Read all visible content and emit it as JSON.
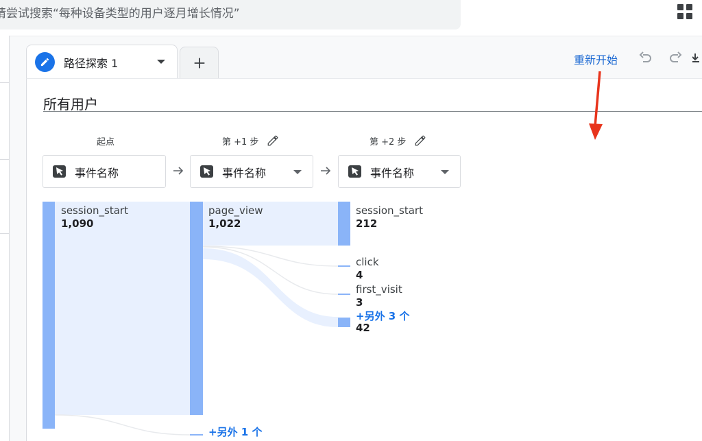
{
  "search": {
    "text": "请尝试搜索“每种设备类型的用户逐月增长情况”"
  },
  "tabs": [
    {
      "label": "路径探索 1"
    }
  ],
  "toolbar": {
    "restart_label": "重新开始"
  },
  "segment": {
    "label": "所有用户"
  },
  "columns": [
    {
      "heading": "起点",
      "node_label": "事件名称",
      "editable": false,
      "has_dropdown": false
    },
    {
      "heading": "第 +1 步",
      "node_label": "事件名称",
      "editable": true,
      "has_dropdown": true
    },
    {
      "heading": "第 +2 步",
      "node_label": "事件名称",
      "editable": true,
      "has_dropdown": true
    }
  ],
  "flow": {
    "step0": [
      {
        "name": "session_start",
        "count": "1,090"
      }
    ],
    "step1": [
      {
        "name": "page_view",
        "count": "1,022"
      },
      {
        "more": "+另外 1 个"
      }
    ],
    "step2": [
      {
        "name": "session_start",
        "count": "212"
      },
      {
        "name": "click",
        "count": "4"
      },
      {
        "name": "first_visit",
        "count": "3"
      },
      {
        "more": "+另外 3 个",
        "count": "42"
      }
    ]
  },
  "colors": {
    "bar": "#8ab4f8",
    "link": "#1a73e8",
    "flow": "#e8f0fe",
    "annotation_arrow": "#e8341c"
  },
  "icons": [
    "apps-grid-icon",
    "pencil-icon",
    "add-icon",
    "undo-icon",
    "redo-icon",
    "download-icon",
    "cursor-icon",
    "arrow-right-icon",
    "dropdown-caret-icon"
  ]
}
